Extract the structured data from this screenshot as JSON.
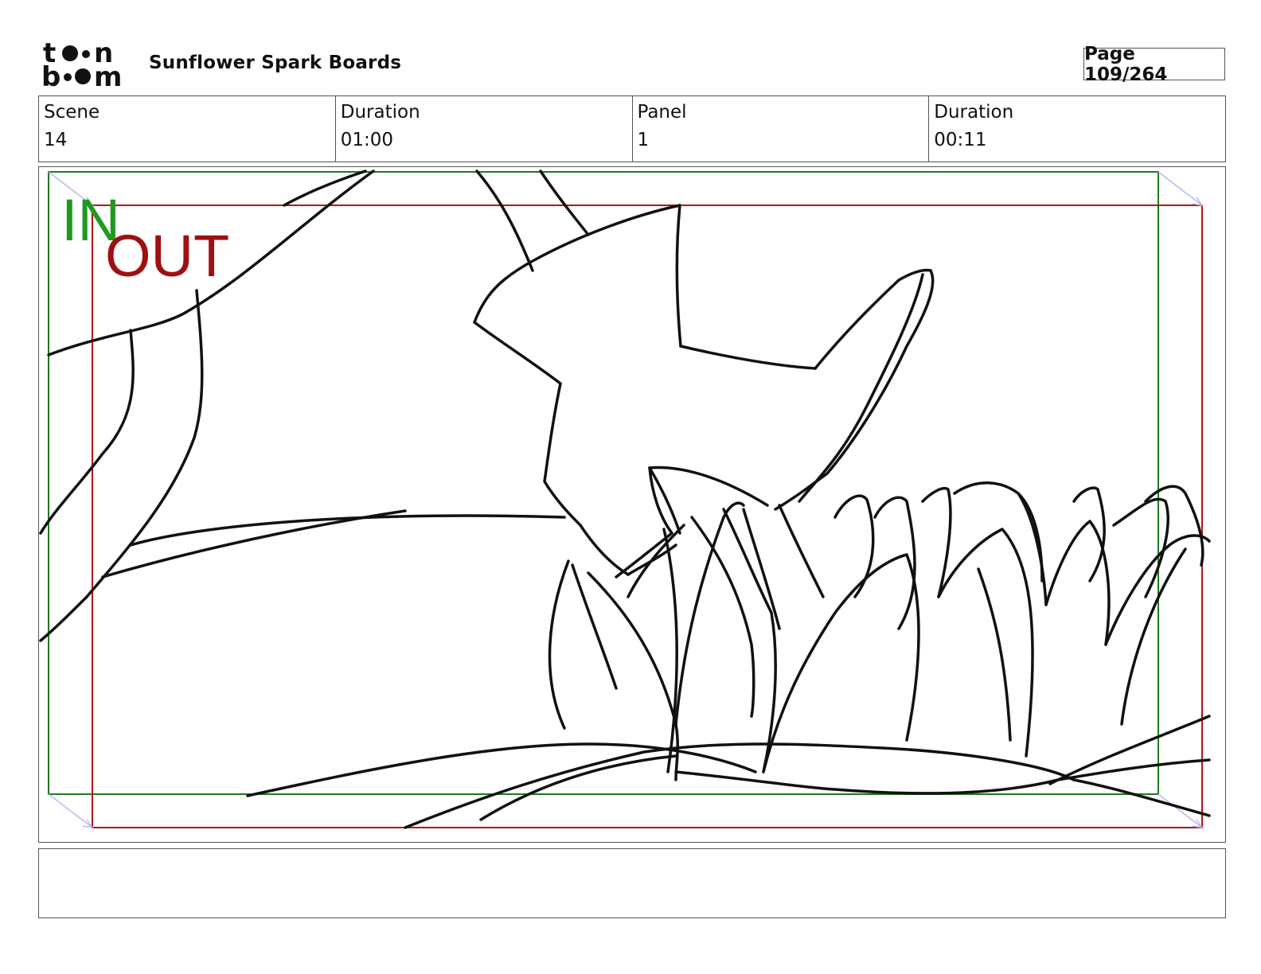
{
  "header": {
    "logo_text": "toon boom",
    "project_title": "Sunflower Spark Boards",
    "page_label": "Page 109/264"
  },
  "info": {
    "scene_label": "Scene",
    "scene_value": "14",
    "scene_duration_label": "Duration",
    "scene_duration_value": "01:00",
    "panel_label": "Panel",
    "panel_value": "1",
    "panel_duration_label": "Duration",
    "panel_duration_value": "00:11"
  },
  "panel": {
    "in_label": "IN",
    "out_label": "OUT",
    "in_color": "#1f9a1f",
    "out_color": "#a01010"
  },
  "notes": {
    "text": ""
  }
}
